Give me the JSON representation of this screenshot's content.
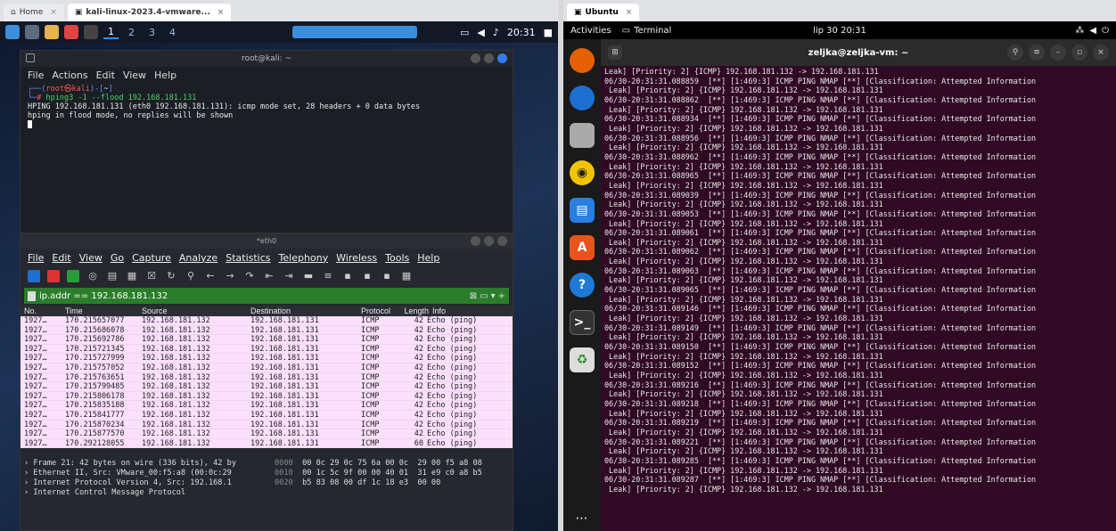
{
  "left_vm": {
    "tabs": [
      {
        "label": "Home"
      },
      {
        "label": "kali-linux-2023.4-vmware..."
      }
    ],
    "panel": {
      "workspaces": [
        "1",
        "2",
        "3",
        "4"
      ],
      "time": "20:31"
    },
    "terminal": {
      "title": "root@kali: ~",
      "menu": [
        "File",
        "Actions",
        "Edit",
        "View",
        "Help"
      ],
      "prompt_user": "root",
      "prompt_host": "kali",
      "prompt_dir": "~",
      "command": "hping3 -1 --flood 192.168.181.131",
      "output1": "HPING 192.168.181.131 (eth0 192.168.181.131): icmp mode set, 28 headers + 0 data bytes",
      "output2": "hping in flood mode, no replies will be shown"
    },
    "wireshark": {
      "title": "*eth0",
      "menu": [
        "File",
        "Edit",
        "View",
        "Go",
        "Capture",
        "Analyze",
        "Statistics",
        "Telephony",
        "Wireless",
        "Tools",
        "Help"
      ],
      "filter": "ip.addr == 192.168.181.132",
      "columns": {
        "no": "No.",
        "time": "Time",
        "source": "Source",
        "destination": "Destination",
        "protocol": "Protocol",
        "length": "Length",
        "info": "Info"
      },
      "rows": [
        {
          "no": "1927…",
          "time": "170.215657077",
          "src": "192.168.181.132",
          "dst": "192.168.181.131",
          "proto": "ICMP",
          "len": "42",
          "info": "Echo (ping)"
        },
        {
          "no": "1927…",
          "time": "170.215686078",
          "src": "192.168.181.132",
          "dst": "192.168.181.131",
          "proto": "ICMP",
          "len": "42",
          "info": "Echo (ping)"
        },
        {
          "no": "1927…",
          "time": "170.215692786",
          "src": "192.168.181.132",
          "dst": "192.168.181.131",
          "proto": "ICMP",
          "len": "42",
          "info": "Echo (ping)"
        },
        {
          "no": "1927…",
          "time": "170.215721345",
          "src": "192.168.181.132",
          "dst": "192.168.181.131",
          "proto": "ICMP",
          "len": "42",
          "info": "Echo (ping)"
        },
        {
          "no": "1927…",
          "time": "170.215727999",
          "src": "192.168.181.132",
          "dst": "192.168.181.131",
          "proto": "ICMP",
          "len": "42",
          "info": "Echo (ping)"
        },
        {
          "no": "1927…",
          "time": "170.215757052",
          "src": "192.168.181.132",
          "dst": "192.168.181.131",
          "proto": "ICMP",
          "len": "42",
          "info": "Echo (ping)"
        },
        {
          "no": "1927…",
          "time": "170.215763651",
          "src": "192.168.181.132",
          "dst": "192.168.181.131",
          "proto": "ICMP",
          "len": "42",
          "info": "Echo (ping)"
        },
        {
          "no": "1927…",
          "time": "170.215799485",
          "src": "192.168.181.132",
          "dst": "192.168.181.131",
          "proto": "ICMP",
          "len": "42",
          "info": "Echo (ping)"
        },
        {
          "no": "1927…",
          "time": "170.215806178",
          "src": "192.168.181.132",
          "dst": "192.168.181.131",
          "proto": "ICMP",
          "len": "42",
          "info": "Echo (ping)"
        },
        {
          "no": "1927…",
          "time": "170.215835188",
          "src": "192.168.181.132",
          "dst": "192.168.181.131",
          "proto": "ICMP",
          "len": "42",
          "info": "Echo (ping)"
        },
        {
          "no": "1927…",
          "time": "170.215841777",
          "src": "192.168.181.132",
          "dst": "192.168.181.131",
          "proto": "ICMP",
          "len": "42",
          "info": "Echo (ping)"
        },
        {
          "no": "1927…",
          "time": "170.215870234",
          "src": "192.168.181.132",
          "dst": "192.168.181.131",
          "proto": "ICMP",
          "len": "42",
          "info": "Echo (ping)"
        },
        {
          "no": "1927…",
          "time": "170.215877570",
          "src": "192.168.181.132",
          "dst": "192.168.181.131",
          "proto": "ICMP",
          "len": "42",
          "info": "Echo (ping)"
        },
        {
          "no": "1927…",
          "time": "170.292128055",
          "src": "192.168.181.132",
          "dst": "192.168.181.131",
          "proto": "ICMP",
          "len": "60",
          "info": "Echo (ping)"
        }
      ],
      "details": [
        "› Frame 21: 42 bytes on wire (336 bits), 42 by",
        "› Ethernet II, Src: VMware_00:f5:a8 (00:0c:29",
        "› Internet Protocol Version 4, Src: 192.168.1",
        "› Internet Control Message Protocol"
      ],
      "hex": [
        {
          "off": "0000",
          "bytes": "00 0c 29 0c 75 6a 00 0c  29 00 f5 a8 08"
        },
        {
          "off": "0010",
          "bytes": "00 1c 5c 9f 00 00 40 01  31 e9 c0 a8 b5"
        },
        {
          "off": "0020",
          "bytes": "b5 83 08 00 df 1c 18 e3  00 00"
        }
      ]
    }
  },
  "right_vm": {
    "tab": "Ubuntu",
    "topbar": {
      "activities": "Activities",
      "app": "Terminal",
      "clock": "lip 30 20:31"
    },
    "terminal_title": "zeljka@zeljka-vm: ~",
    "log_first": "Leak] [Priority: 2] {ICMP} 192.168.181.132 -> 192.168.181.131",
    "log_entries": [
      "06/30-20:31:31.088859",
      "06/30-20:31:31.088862",
      "06/30-20:31:31.088934",
      "06/30-20:31:31.088956",
      "06/30-20:31:31.088962",
      "06/30-20:31:31.088965",
      "06/30-20:31:31.089039",
      "06/30-20:31:31.089053",
      "06/30-20:31:31.089061",
      "06/30-20:31:31.089062",
      "06/30-20:31:31.089063",
      "06/30-20:31:31.089065",
      "06/30-20:31:31.089146",
      "06/30-20:31:31.089149",
      "06/30-20:31:31.089150",
      "06/30-20:31:31.089152",
      "06/30-20:31:31.089216",
      "06/30-20:31:31.089218",
      "06/30-20:31:31.089219",
      "06/30-20:31:31.089221",
      "06/30-20:31:31.089285",
      "06/30-20:31:31.089287"
    ],
    "log_alert": "  [**] [1:469:3] ICMP PING NMAP [**] [Classification: Attempted Information",
    "log_leak": " Leak] [Priority: 2] {ICMP} 192.168.181.132 -> 192.168.181.131"
  }
}
